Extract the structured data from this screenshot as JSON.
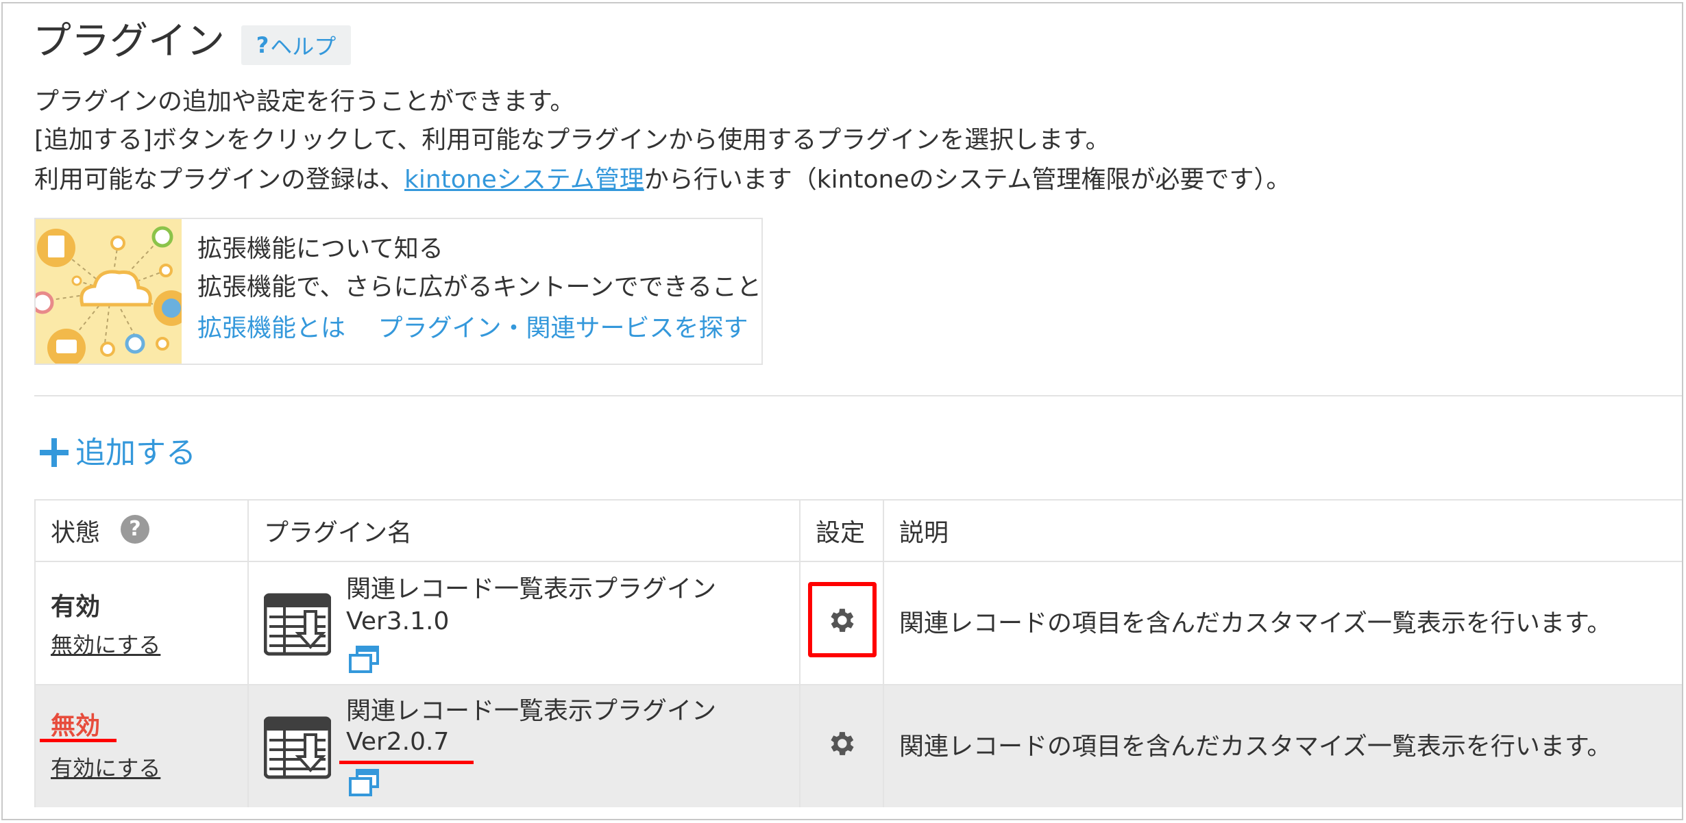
{
  "page": {
    "title": "プラグイン",
    "help_label": "ヘルプ",
    "help_prefix": "?"
  },
  "description": {
    "line1": "プラグインの追加や設定を行うことができます。",
    "line2": "[追加する]ボタンをクリックして、利用可能なプラグインから使用するプラグインを選択します。",
    "line3_pre": "利用可能なプラグインの登録は、",
    "line3_link": "kintoneシステム管理",
    "line3_post": "から行います（kintoneのシステム管理権限が必要です）。"
  },
  "promo": {
    "heading": "拡張機能について知る",
    "subtext": "拡張機能で、さらに広がるキントーンでできること",
    "link1": "拡張機能とは",
    "link2": "プラグイン・関連サービスを探す"
  },
  "add_button": {
    "label": "追加する"
  },
  "table": {
    "headers": {
      "status": "状態",
      "status_help": "?",
      "name": "プラグイン名",
      "settings": "設定",
      "description": "説明"
    },
    "rows": [
      {
        "status": "有効",
        "toggle": "無効にする",
        "name": "関連レコード一覧表示プラグイン",
        "version": "Ver3.1.0",
        "description": "関連レコードの項目を含んだカスタマイズ一覧表示を行います。"
      },
      {
        "status": "無効",
        "toggle": "有効にする",
        "name": "関連レコード一覧表示プラグイン",
        "version": "Ver2.0.7",
        "description": "関連レコードの項目を含んだカスタマイズ一覧表示を行います。"
      }
    ]
  },
  "colors": {
    "link": "#3498db",
    "disabled_status": "#e74c3c",
    "highlight": "#ff0000",
    "disabled_row_bg": "#ebebeb"
  },
  "icons": {
    "help": "question-mark",
    "add": "plus-icon",
    "plugin": "plugin-list-download-icon",
    "window": "new-window-icon",
    "settings": "gear-icon",
    "promo": "cloud-network-illustration"
  }
}
